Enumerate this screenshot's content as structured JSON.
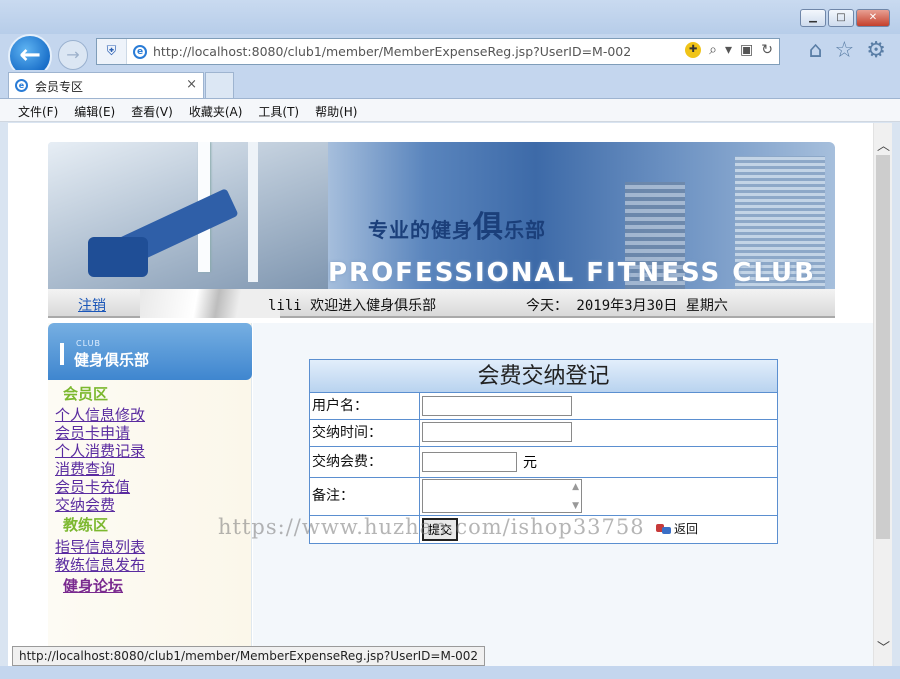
{
  "browser": {
    "url": "http://localhost:8080/club1/member/MemberExpenseReg.jsp?UserID=M-002",
    "tab_title": "会员专区",
    "tab_close": "×",
    "menu": [
      "文件(F)",
      "编辑(E)",
      "查看(V)",
      "收藏夹(A)",
      "工具(T)",
      "帮助(H)"
    ],
    "status_url": "http://localhost:8080/club1/member/MemberExpenseReg.jsp?UserID=M-002"
  },
  "banner": {
    "slogan_part1": "专业的健身",
    "slogan_big": "俱",
    "slogan_part2": "乐部",
    "subtitle": "PROFESSIONAL FITNESS CLUB"
  },
  "topbar": {
    "logout": "注销",
    "welcome": "lili 欢迎进入健身俱乐部",
    "today": "今天： 2019年3月30日 星期六"
  },
  "sidebar": {
    "club_small": "CLUB",
    "club_name": "健身俱乐部",
    "member_section": "会员区",
    "member_links": [
      "个人信息修改",
      "会员卡申请",
      "个人消费记录",
      "消费查询",
      "会员卡充值",
      "交纳会费"
    ],
    "coach_section": "教练区",
    "coach_links": [
      "指导信息列表",
      "教练信息发布"
    ],
    "forum": "健身论坛"
  },
  "form": {
    "title": "会费交纳登记",
    "username_label": "用户名：",
    "username_value": "",
    "time_label": "交纳时间：",
    "time_value": "",
    "fee_label": "交纳会费：",
    "fee_value": "",
    "fee_unit": "元",
    "remark_label": "备注：",
    "remark_value": "",
    "submit": "提交",
    "back": "返回"
  },
  "watermark": "https://www.huzhan.com/ishop33758"
}
